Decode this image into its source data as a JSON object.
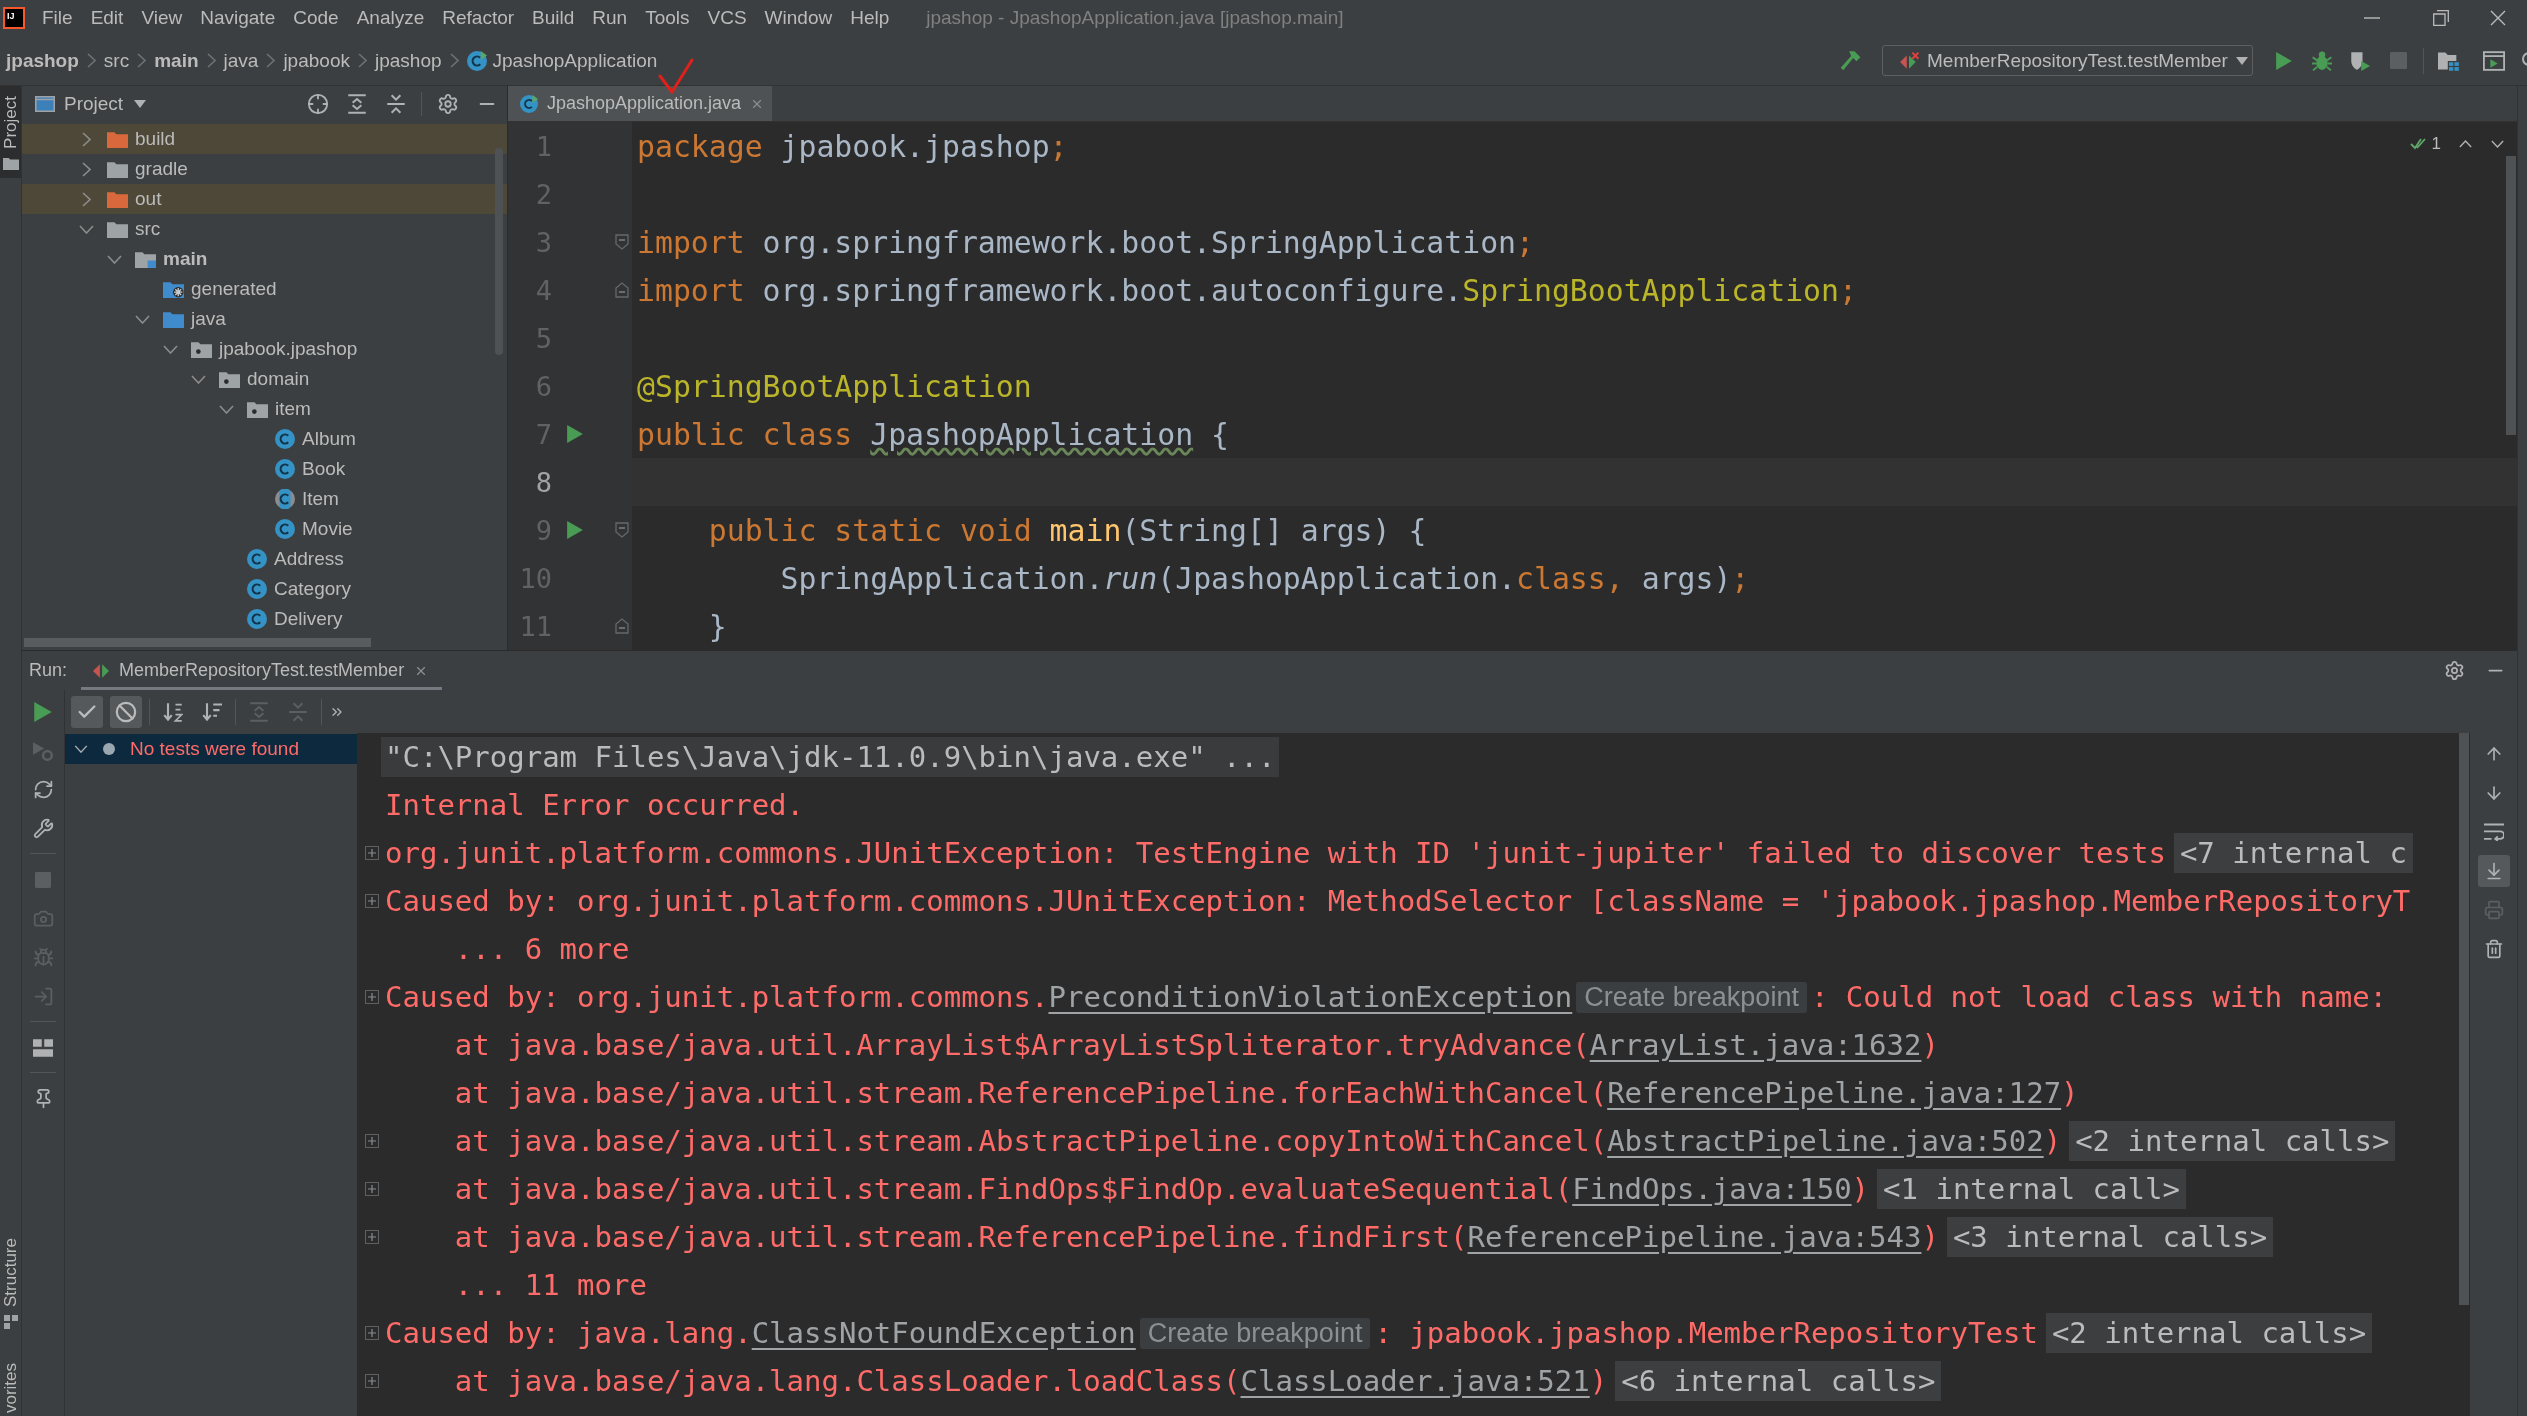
{
  "menu_bar": {
    "logo": "IJ",
    "items": [
      "File",
      "Edit",
      "View",
      "Navigate",
      "Code",
      "Analyze",
      "Refactor",
      "Build",
      "Run",
      "Tools",
      "VCS",
      "Window",
      "Help"
    ],
    "title": "jpashop - JpashopApplication.java [jpashop.main]"
  },
  "breadcrumbs": [
    {
      "label": "jpashop",
      "kind": "module"
    },
    {
      "label": "src",
      "kind": "folder"
    },
    {
      "label": "main",
      "kind": "module"
    },
    {
      "label": "java",
      "kind": "folder"
    },
    {
      "label": "jpabook",
      "kind": "folder"
    },
    {
      "label": "jpashop",
      "kind": "folder"
    },
    {
      "label": "JpashopApplication",
      "kind": "class"
    }
  ],
  "main_toolbar": {
    "run_configuration": "MemberRepositoryTest.testMember",
    "buttons": [
      {
        "disabled": false
      },
      {
        "disabled": false
      },
      {
        "disabled": false
      },
      {
        "disabled": false
      },
      {
        "disabled": true
      },
      {
        "disabled": false
      },
      {
        "disabled": false
      },
      {
        "disabled": false
      }
    ]
  },
  "side_stripe": {
    "top": [
      {
        "label": "Project",
        "selected": true
      }
    ],
    "bottom": [
      {
        "label": "Structure",
        "selected": false
      },
      {
        "label": "vorites",
        "selected": false
      }
    ]
  },
  "project_panel": {
    "title": "Project",
    "tree": [
      {
        "label": "build",
        "kind": "excluded-folder",
        "expanded": false
      },
      {
        "label": "gradle",
        "kind": "folder",
        "expanded": false
      },
      {
        "label": "out",
        "kind": "excluded-folder",
        "expanded": false
      },
      {
        "label": "src",
        "kind": "folder",
        "expanded": true,
        "children": [
          {
            "label": "main",
            "kind": "source-set",
            "expanded": true,
            "children": [
              {
                "label": "generated",
                "kind": "generated-folder"
              },
              {
                "label": "java",
                "kind": "source-folder",
                "expanded": true,
                "children": [
                  {
                    "label": "jpabook.jpashop",
                    "kind": "package",
                    "expanded": true,
                    "children": [
                      {
                        "label": "domain",
                        "kind": "package",
                        "expanded": true,
                        "children": [
                          {
                            "label": "item",
                            "kind": "package",
                            "expanded": true,
                            "children": [
                              {
                                "label": "Album",
                                "kind": "class"
                              },
                              {
                                "label": "Book",
                                "kind": "class"
                              },
                              {
                                "label": "Item",
                                "kind": "abstract-class"
                              },
                              {
                                "label": "Movie",
                                "kind": "class"
                              }
                            ]
                          },
                          {
                            "label": "Address",
                            "kind": "class"
                          },
                          {
                            "label": "Category",
                            "kind": "class"
                          },
                          {
                            "label": "Delivery",
                            "kind": "class"
                          }
                        ]
                      }
                    ]
                  }
                ]
              }
            ]
          }
        ]
      }
    ]
  },
  "editor": {
    "tabs": [
      {
        "label": "JpashopApplication.java",
        "selected": true
      }
    ],
    "inspection_count": "1",
    "lines": [
      {
        "number": "1",
        "current": false,
        "run_marker": false,
        "fold_start": false,
        "fold_end": false,
        "tokens": [
          {
            "kind": "keyword",
            "text": "package"
          },
          {
            "kind": "plain",
            "text": " jpabook.jpashop"
          },
          {
            "kind": "keyword",
            "text": ";"
          }
        ]
      },
      {
        "number": "2",
        "current": false,
        "run_marker": false,
        "fold_start": false,
        "fold_end": false
      },
      {
        "number": "3",
        "current": false,
        "run_marker": false,
        "fold_start": true,
        "fold_end": false,
        "tokens": [
          {
            "kind": "keyword",
            "text": "import"
          },
          {
            "kind": "plain",
            "text": " org.springframework.boot.SpringApplication"
          },
          {
            "kind": "keyword",
            "text": ";"
          }
        ]
      },
      {
        "number": "4",
        "current": false,
        "run_marker": false,
        "fold_start": false,
        "fold_end": true,
        "tokens": [
          {
            "kind": "keyword",
            "text": "import"
          },
          {
            "kind": "plain",
            "text": " org.springframework.boot.autoconfigure."
          },
          {
            "kind": "annotation",
            "text": "SpringBootApplication"
          },
          {
            "kind": "keyword",
            "text": ";"
          }
        ]
      },
      {
        "number": "5",
        "current": false,
        "run_marker": false,
        "fold_start": false,
        "fold_end": false
      },
      {
        "number": "6",
        "current": false,
        "run_marker": false,
        "fold_start": false,
        "fold_end": false,
        "tokens": [
          {
            "kind": "annotation",
            "text": "@SpringBootApplication"
          }
        ]
      },
      {
        "number": "7",
        "current": false,
        "run_marker": true,
        "fold_start": false,
        "fold_end": false,
        "tokens": [
          {
            "kind": "keyword",
            "text": "public class "
          },
          {
            "kind": "typo",
            "text": "JpashopApplication"
          },
          {
            "kind": "plain",
            "text": " {"
          }
        ]
      },
      {
        "number": "8",
        "current": true,
        "run_marker": false,
        "fold_start": false,
        "fold_end": false
      },
      {
        "number": "9",
        "current": false,
        "run_marker": true,
        "fold_start": true,
        "fold_end": false,
        "tokens": [
          {
            "kind": "keyword",
            "text": "    public static void "
          },
          {
            "kind": "method",
            "text": "main"
          },
          {
            "kind": "plain",
            "text": "(String[] args) {"
          }
        ]
      },
      {
        "number": "10",
        "current": false,
        "run_marker": false,
        "fold_start": false,
        "fold_end": false,
        "tokens": [
          {
            "kind": "plain",
            "text": "        SpringApplication."
          },
          {
            "kind": "static-call",
            "text": "run"
          },
          {
            "kind": "plain",
            "text": "(JpashopApplication."
          },
          {
            "kind": "keyword",
            "text": "class, "
          },
          {
            "kind": "plain",
            "text": "args)"
          },
          {
            "kind": "keyword",
            "text": ";"
          }
        ]
      },
      {
        "number": "11",
        "current": false,
        "run_marker": false,
        "fold_start": false,
        "fold_end": true,
        "tokens": [
          {
            "kind": "plain",
            "text": "    }"
          }
        ]
      }
    ]
  },
  "run_panel": {
    "label": "Run:",
    "tabs": [
      {
        "label": "MemberRepositoryTest.testMember",
        "selected": true
      }
    ],
    "side_buttons": [
      {
        "disabled": false
      },
      {
        "disabled": true
      },
      {
        "disabled": false
      },
      {
        "disabled": false
      },
      {
        "disabled": true
      },
      {
        "disabled": true
      },
      {
        "disabled": true
      },
      {
        "disabled": true
      },
      {
        "disabled": false
      },
      {
        "disabled": false
      }
    ],
    "filter_toggles": [
      {
        "on": true
      },
      {
        "on": true
      }
    ],
    "tree_buttons": [
      {
        "disabled": false
      },
      {
        "disabled": false
      },
      {
        "disabled": true
      },
      {
        "disabled": true
      }
    ],
    "test_tree": [
      {
        "label": "No tests were found",
        "expanded": true,
        "selected": true
      }
    ],
    "console": [
      {
        "kind": "command",
        "expandable": false,
        "segments": [
          {
            "kind": "text",
            "text": "\"C:\\Program Files\\Java\\jdk-11.0.9\\bin\\java.exe\" ..."
          }
        ]
      },
      {
        "kind": "error",
        "expandable": false,
        "segments": [
          {
            "kind": "text",
            "text": "Internal Error occurred."
          }
        ]
      },
      {
        "kind": "error",
        "expandable": true,
        "segments": [
          {
            "kind": "text",
            "text": "org.junit.platform.commons.JUnitException: TestEngine with ID 'junit-jupiter' failed to discover tests"
          },
          {
            "kind": "fold",
            "text": "<7 internal c"
          }
        ]
      },
      {
        "kind": "error",
        "expandable": true,
        "segments": [
          {
            "kind": "text",
            "text": "Caused by: org.junit.platform.commons.JUnitException: MethodSelector [className = 'jpabook.jpashop.MemberRepositoryT"
          }
        ]
      },
      {
        "kind": "error",
        "expandable": false,
        "segments": [
          {
            "kind": "text",
            "text": "    ... 6 more"
          }
        ]
      },
      {
        "kind": "error",
        "expandable": true,
        "segments": [
          {
            "kind": "text",
            "text": "Caused by: org.junit.platform.commons."
          },
          {
            "kind": "link",
            "text": "PreconditionViolationException"
          },
          {
            "kind": "hint",
            "text": "Create breakpoint"
          },
          {
            "kind": "text",
            "text": ": Could not load class with name:"
          }
        ]
      },
      {
        "kind": "error",
        "expandable": false,
        "segments": [
          {
            "kind": "text",
            "text": "    at java.base/java.util.ArrayList$ArrayListSpliterator.tryAdvance("
          },
          {
            "kind": "link",
            "text": "ArrayList.java:1632"
          },
          {
            "kind": "text",
            "text": ")"
          }
        ]
      },
      {
        "kind": "error",
        "expandable": false,
        "segments": [
          {
            "kind": "text",
            "text": "    at java.base/java.util.stream.ReferencePipeline.forEachWithCancel("
          },
          {
            "kind": "link",
            "text": "ReferencePipeline.java:127"
          },
          {
            "kind": "text",
            "text": ")"
          }
        ]
      },
      {
        "kind": "error",
        "expandable": true,
        "segments": [
          {
            "kind": "text",
            "text": "    at java.base/java.util.stream.AbstractPipeline.copyIntoWithCancel("
          },
          {
            "kind": "link",
            "text": "AbstractPipeline.java:502"
          },
          {
            "kind": "text",
            "text": ")"
          },
          {
            "kind": "fold",
            "text": "<2 internal calls>"
          }
        ]
      },
      {
        "kind": "error",
        "expandable": true,
        "segments": [
          {
            "kind": "text",
            "text": "    at java.base/java.util.stream.FindOps$FindOp.evaluateSequential("
          },
          {
            "kind": "link",
            "text": "FindOps.java:150"
          },
          {
            "kind": "text",
            "text": ")"
          },
          {
            "kind": "fold",
            "text": "<1 internal call>"
          }
        ]
      },
      {
        "kind": "error",
        "expandable": true,
        "segments": [
          {
            "kind": "text",
            "text": "    at java.base/java.util.stream.ReferencePipeline.findFirst("
          },
          {
            "kind": "link",
            "text": "ReferencePipeline.java:543"
          },
          {
            "kind": "text",
            "text": ")"
          },
          {
            "kind": "fold",
            "text": "<3 internal calls>"
          }
        ]
      },
      {
        "kind": "error",
        "expandable": false,
        "segments": [
          {
            "kind": "text",
            "text": "    ... 11 more"
          }
        ]
      },
      {
        "kind": "error",
        "expandable": true,
        "segments": [
          {
            "kind": "text",
            "text": "Caused by: java.lang."
          },
          {
            "kind": "link",
            "text": "ClassNotFoundException"
          },
          {
            "kind": "hint",
            "text": "Create breakpoint"
          },
          {
            "kind": "text",
            "text": ": jpabook.jpashop.MemberRepositoryTest"
          },
          {
            "kind": "fold",
            "text": "<2 internal calls>"
          }
        ]
      },
      {
        "kind": "error",
        "expandable": true,
        "segments": [
          {
            "kind": "text",
            "text": "    at java.base/java.lang.ClassLoader.loadClass("
          },
          {
            "kind": "link",
            "text": "ClassLoader.java:521"
          },
          {
            "kind": "text",
            "text": ")"
          },
          {
            "kind": "fold",
            "text": "<6 internal calls>"
          }
        ]
      }
    ],
    "console_buttons": [
      {
        "disabled": false
      },
      {
        "disabled": false
      },
      {
        "on": false,
        "disabled": false
      },
      {
        "on": true,
        "disabled": false
      },
      {
        "disabled": true
      },
      {
        "disabled": false
      }
    ]
  }
}
